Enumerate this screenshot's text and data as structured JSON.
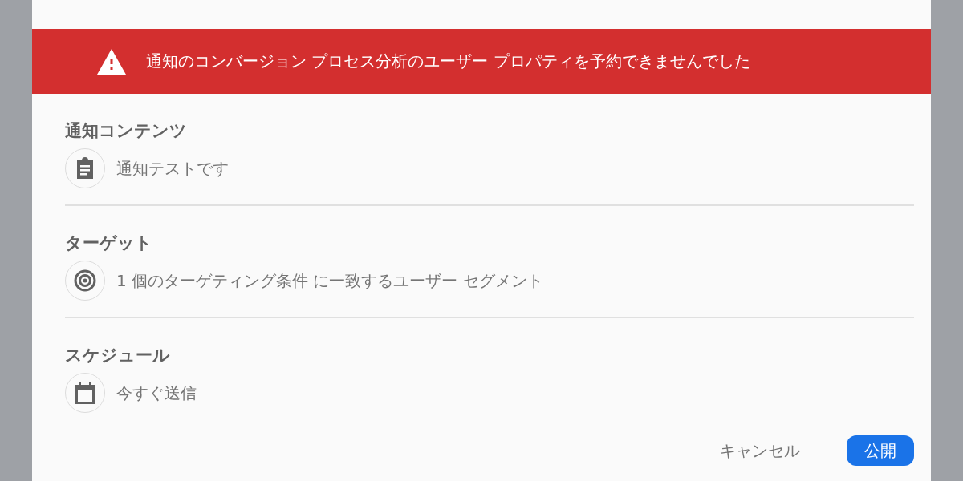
{
  "banner": {
    "message": "通知のコンバージョン プロセス分析のユーザー プロパティを予約できませんでした"
  },
  "sections": [
    {
      "heading": "通知コンテンツ",
      "kind": "content",
      "text": "通知テストです"
    },
    {
      "heading": "ターゲット",
      "kind": "target",
      "text": "1 個のターゲティング条件 に一致するユーザー セグメント"
    },
    {
      "heading": "スケジュール",
      "kind": "schedule",
      "text": "今すぐ送信"
    }
  ],
  "buttons": [
    {
      "label": "キャンセル",
      "kind": "text"
    },
    {
      "label": "公開",
      "kind": "primary"
    }
  ]
}
